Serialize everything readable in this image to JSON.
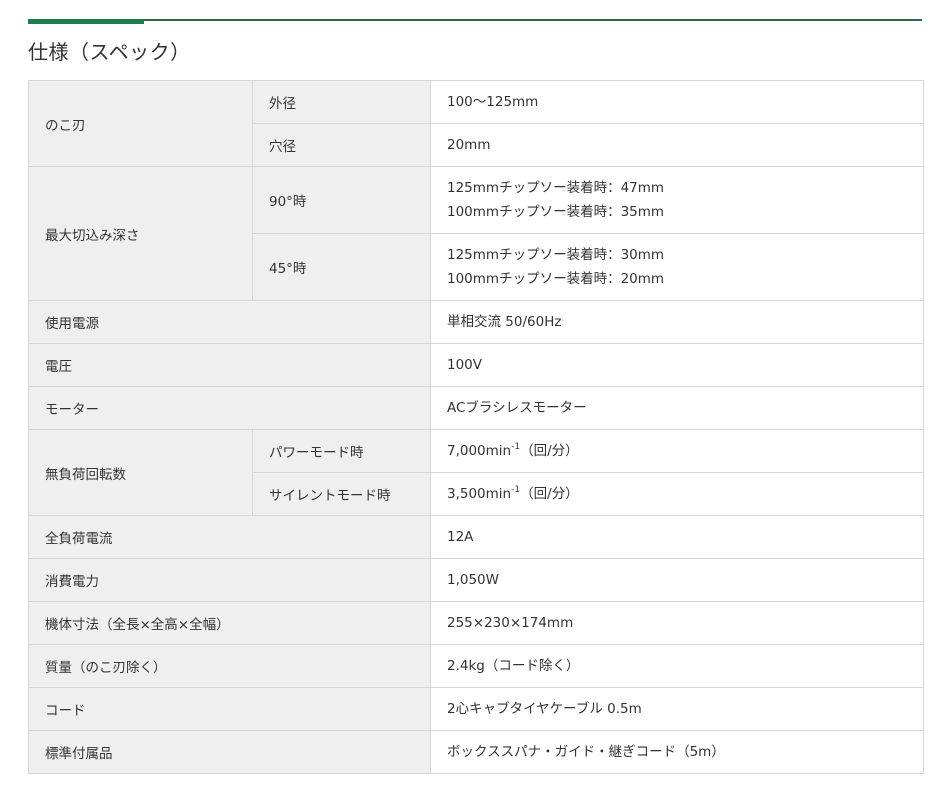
{
  "title": "仕様（スペック）",
  "colors": {
    "accent": "#1f7a52",
    "header_bg": "#efefef",
    "border": "#d6d6d6"
  },
  "spec": {
    "blade_label": "のこ刃",
    "blade_outer_label": "外径",
    "blade_outer_value": "100～125mm",
    "blade_hole_label": "穴径",
    "blade_hole_value": "20mm",
    "depth_label": "最大切込み深さ",
    "depth_90_label": "90°時",
    "depth_90_line1": "125mmチップソー装着時：47mm",
    "depth_90_line2": "100mmチップソー装着時：35mm",
    "depth_45_label": "45°時",
    "depth_45_line1": "125mmチップソー装着時：30mm",
    "depth_45_line2": "100mmチップソー装着時：20mm",
    "power_source_label": "使用電源",
    "power_source_value": "単相交流 50/60Hz",
    "voltage_label": "電圧",
    "voltage_value": "100V",
    "motor_label": "モーター",
    "motor_value": "ACブラシレスモーター",
    "noload_label": "無負荷回転数",
    "power_mode_label": "パワーモード時",
    "power_mode_value": "7,000min",
    "power_mode_sup": "-1",
    "power_mode_unit": "（回/分）",
    "silent_mode_label": "サイレントモード時",
    "silent_mode_value": "3,500min",
    "silent_mode_sup": "-1",
    "silent_mode_unit": "（回/分）",
    "current_label": "全負荷電流",
    "current_value": "12A",
    "consumption_label": "消費電力",
    "consumption_value": "1,050W",
    "dimensions_label": "機体寸法（全長×全高×全幅）",
    "dimensions_value": "255×230×174mm",
    "mass_label": "質量（のこ刃除く）",
    "mass_value": "2.4kg（コード除く）",
    "cord_label": "コード",
    "cord_value": "2心キャブタイヤケーブル 0.5m",
    "accessories_label": "標準付属品",
    "accessories_value": "ボックススパナ・ガイド・継ぎコード（5m）"
  }
}
